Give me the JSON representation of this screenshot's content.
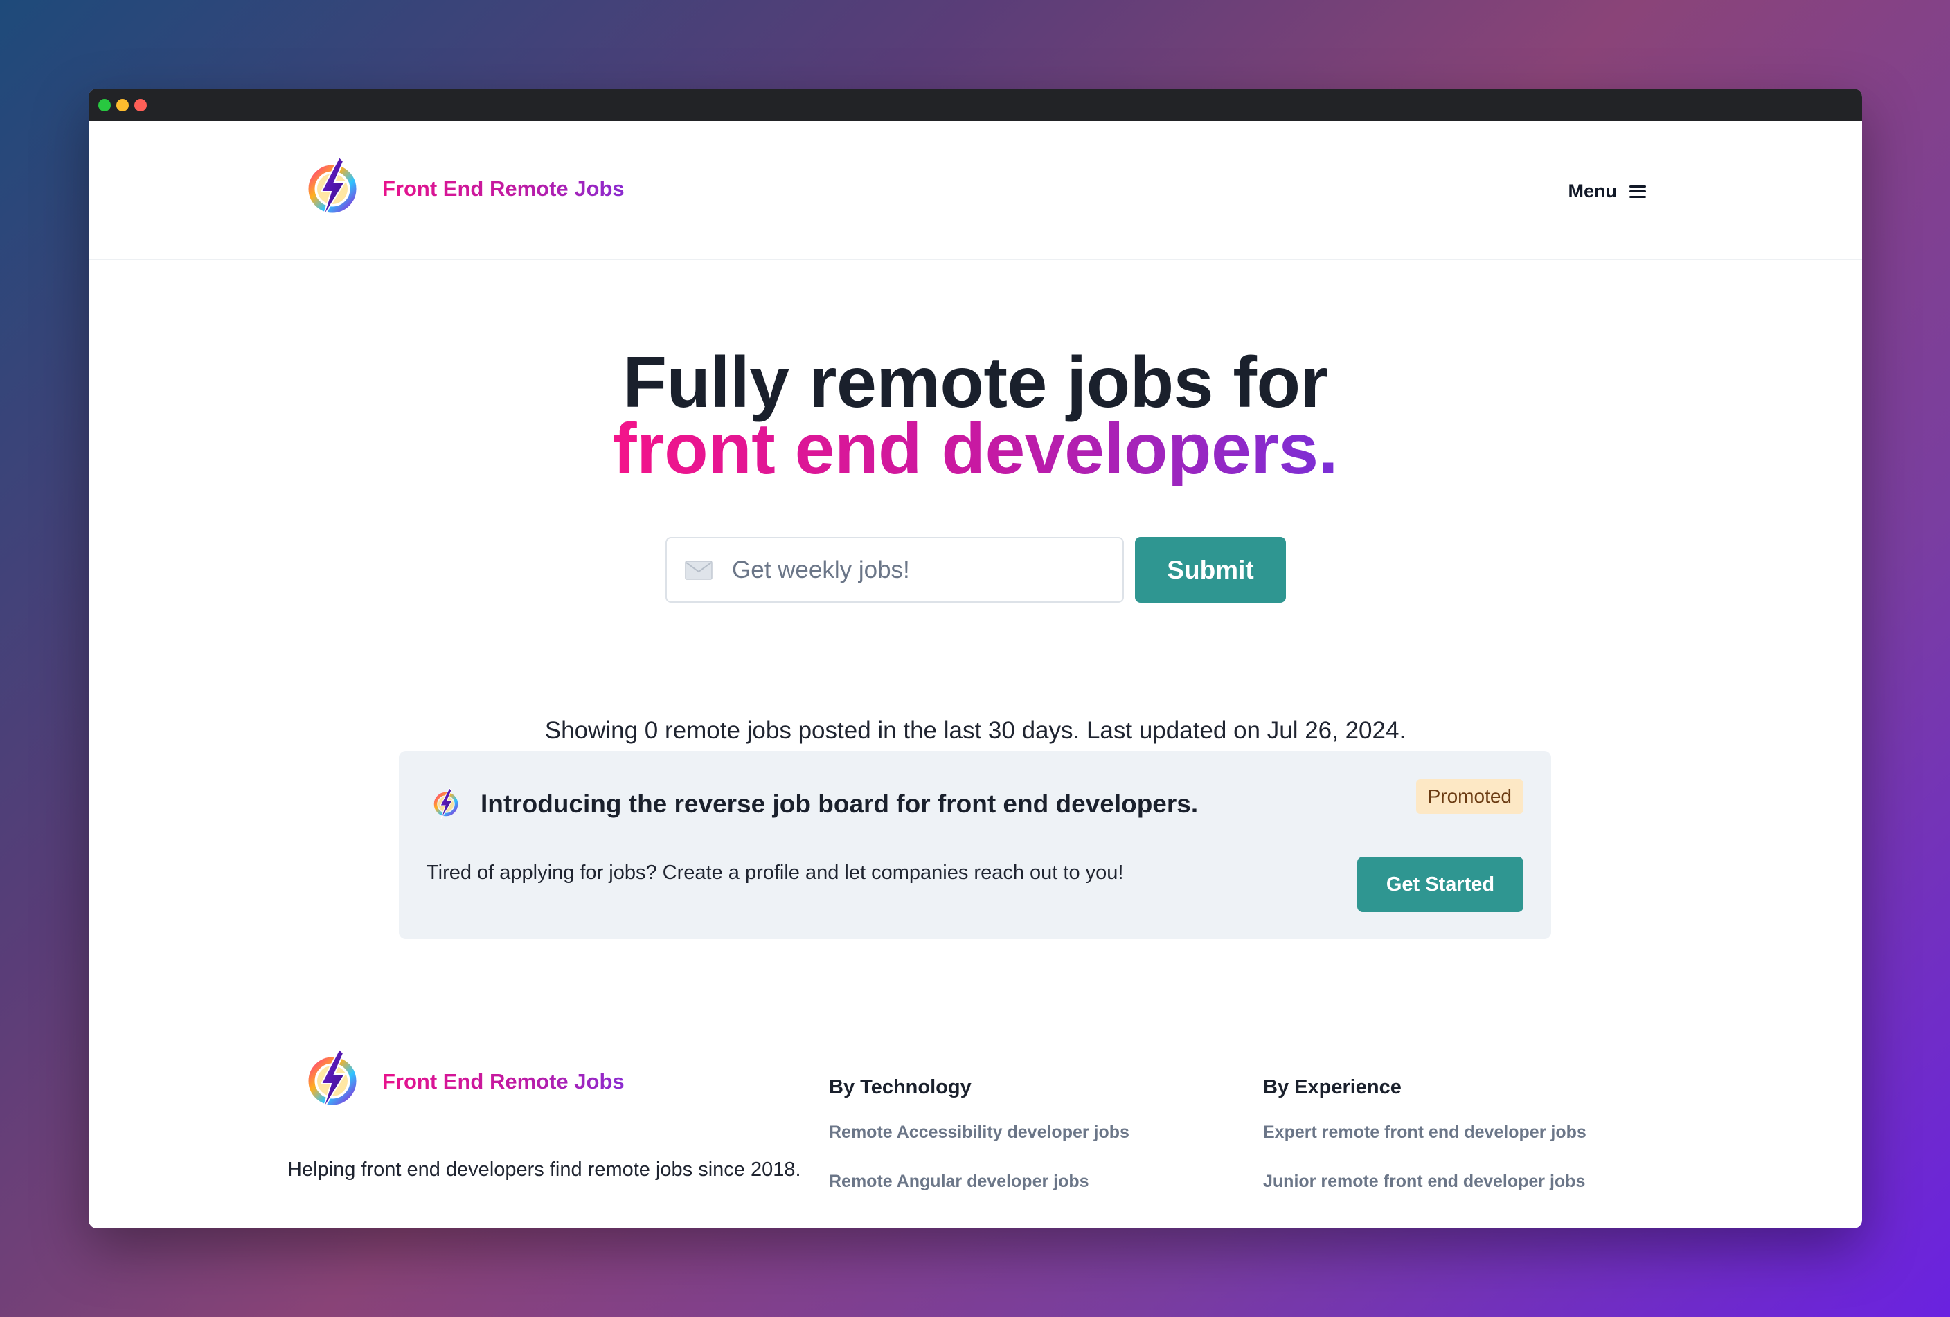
{
  "window": {
    "controls": [
      "green",
      "yellow",
      "red"
    ]
  },
  "header": {
    "brand": "Front End Remote Jobs",
    "menu_label": "Menu"
  },
  "hero": {
    "line1": "Fully remote jobs for",
    "line2": "front end developers."
  },
  "subscribe": {
    "placeholder": "Get weekly jobs!",
    "submit_label": "Submit"
  },
  "status": "Showing 0 remote jobs posted in the last 30 days. Last updated on Jul 26, 2024.",
  "promo": {
    "title": "Introducing the reverse job board for front end developers.",
    "badge": "Promoted",
    "text": "Tired of applying for jobs? Create a profile and let companies reach out to you!",
    "cta": "Get Started"
  },
  "footer": {
    "brand": "Front End Remote Jobs",
    "tagline": "Helping front end developers find remote jobs since 2018.",
    "technology": {
      "heading": "By Technology",
      "links": [
        "Remote Accessibility developer jobs",
        "Remote Angular developer jobs"
      ]
    },
    "experience": {
      "heading": "By Experience",
      "links": [
        "Expert remote front end developer jobs",
        "Junior remote front end developer jobs"
      ]
    }
  },
  "colors": {
    "accent": "#2f9691",
    "brand_pink": "#e8128c",
    "brand_purple": "#8a2bd0",
    "badge_bg": "#fde8c5"
  }
}
